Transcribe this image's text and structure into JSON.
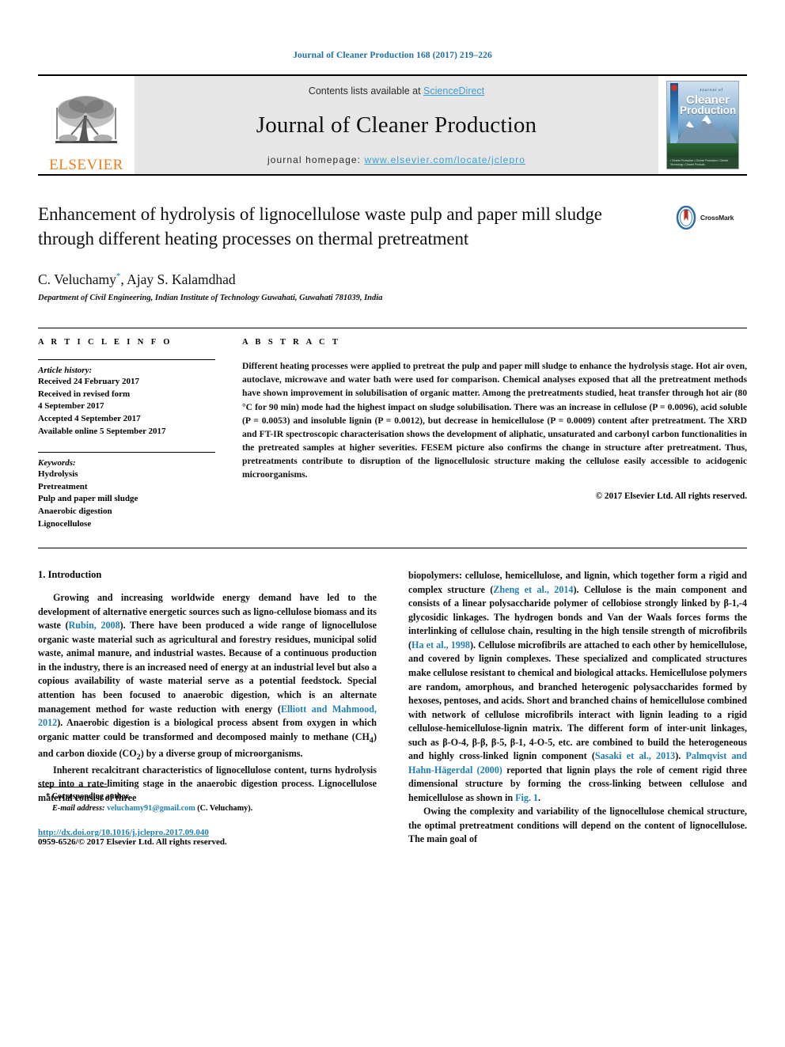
{
  "running_head": "Journal of Cleaner Production 168 (2017) 219–226",
  "masthead": {
    "publisher": "ELSEVIER",
    "contents_prefix": "Contents lists available at ",
    "contents_link": "ScienceDirect",
    "journal_title": "Journal of Cleaner Production",
    "homepage_prefix": "journal homepage: ",
    "homepage_url": "www.elsevier.com/locate/jclepro",
    "cover": {
      "small_top": "Journal of",
      "line1": "Cleaner",
      "line2": "Production",
      "footer_text": "• Cleaner Production  • Cleaner Production\n• Cleaner Technology  • Cleaner Products"
    }
  },
  "article": {
    "title": "Enhancement of hydrolysis of lignocellulose waste pulp and paper mill sludge through different heating processes on thermal pretreatment",
    "crossmark_label": "CrossMark",
    "authors": "C. Veluchamy",
    "authors_star": "*",
    "authors_rest": ", Ajay S. Kalamdhad",
    "affiliation": "Department of Civil Engineering, Indian Institute of Technology Guwahati, Guwahati 781039, India"
  },
  "info": {
    "heading": "A R T I C L E   I N F O",
    "history_label": "Article history:",
    "history_lines": [
      "Received 24 February 2017",
      "Received in revised form",
      "4 September 2017",
      "Accepted 4 September 2017",
      "Available online 5 September 2017"
    ],
    "keywords_label": "Keywords:",
    "keywords": [
      "Hydrolysis",
      "Pretreatment",
      "Pulp and paper mill sludge",
      "Anaerobic digestion",
      "Lignocellulose"
    ]
  },
  "abstract": {
    "heading": "A B S T R A C T",
    "text": "Different heating processes were applied to pretreat the pulp and paper mill sludge to enhance the hydrolysis stage. Hot air oven, autoclave, microwave and water bath were used for comparison. Chemical analyses exposed that all the pretreatment methods have shown improvement in solubilisation of organic matter. Among the pretreatments studied, heat transfer through hot air (80 °C for 90 min) mode had the highest impact on sludge solubilisation. There was an increase in cellulose (P = 0.0096), acid soluble (P = 0.0053) and insoluble lignin (P = 0.0012), but decrease in hemicellulose (P = 0.0009) content after pretreatment. The XRD and FT-IR spectroscopic characterisation shows the development of aliphatic, unsaturated and carbonyl carbon functionalities in the pretreated samples at higher severities. FESEM picture also confirms the change in structure after pretreatment. Thus, pretreatments contribute to disruption of the lignocellulosic structure making the cellulose easily accessible to acidogenic microorganisms.",
    "copyright": "© 2017 Elsevier Ltd. All rights reserved."
  },
  "body": {
    "section_title": "1. Introduction",
    "left_paragraphs": [
      {
        "parts": [
          {
            "t": "Growing and increasing worldwide energy demand have led to the development of alternative energetic sources such as ligno-cellulose biomass and its waste ("
          },
          {
            "t": "Rubin, 2008",
            "ref": true
          },
          {
            "t": "). There have been produced a wide range of lignocellulose organic waste material such as agricultural and forestry residues, municipal solid waste, animal manure, and industrial wastes. Because of a continuous production in the industry, there is an increased need of energy at an industrial level but also a copious availability of waste material serve as a potential feedstock. Special attention has been focused to anaerobic digestion, which is an alternate management method for waste reduction with energy ("
          },
          {
            "t": "Elliott and Mahmood, 2012",
            "ref": true
          },
          {
            "t": "). Anaerobic digestion is a biological process absent from oxygen in which organic matter could be transformed and decomposed mainly to methane (CH4) and carbon dioxide (CO2) by a diverse group of microorganisms."
          }
        ]
      },
      {
        "parts": [
          {
            "t": "Inherent recalcitrant characteristics of lignocellulose content, turns hydrolysis step into a rate-limiting stage in the anaerobic digestion process. Lignocellulose material consist of three"
          }
        ]
      }
    ],
    "right_paragraphs": [
      {
        "continued": true,
        "parts": [
          {
            "t": "biopolymers: cellulose, hemicellulose, and lignin, which together form a rigid and complex structure ("
          },
          {
            "t": "Zheng et al., 2014",
            "ref": true
          },
          {
            "t": "). Cellulose is the main component and consists of a linear polysaccharide polymer of cellobiose strongly linked by β-1,-4 glycosidic linkages. The hydrogen bonds and Van der Waals forces forms the interlinking of cellulose chain, resulting in the high tensile strength of microfibrils ("
          },
          {
            "t": "Ha et al., 1998",
            "ref": true
          },
          {
            "t": "). Cellulose microfibrils are attached to each other by hemicellulose, and covered by lignin complexes. These specialized and complicated structures make cellulose resistant to chemical and biological attacks. Hemicellulose polymers are random, amorphous, and branched heterogenic polysaccharides formed by hexoses, pentoses, and acids. Short and branched chains of hemicellulose combined with network of cellulose microfibrils interact with lignin leading to a rigid cellulose-hemicellulose-lignin matrix. The different form of inter-unit linkages, such as β-O-4, β-β, β-5, β-1, 4-O-5, etc. are combined to build the heterogeneous and highly cross-linked lignin component ("
          },
          {
            "t": "Sasaki et al., 2013",
            "ref": true
          },
          {
            "t": "). "
          },
          {
            "t": "Palmqvist and Hahn-Hägerdal (2000)",
            "ref": true
          },
          {
            "t": " reported that lignin plays the role of cement rigid three dimensional structure by forming the cross-linking between cellulose and hemicellulose as shown in "
          },
          {
            "t": "Fig. 1",
            "ref": true
          },
          {
            "t": "."
          }
        ]
      },
      {
        "parts": [
          {
            "t": "Owing the complexity and variability of the lignocellulose chemical structure, the optimal pretreatment conditions will depend on the content of lignocellulose. The main goal of"
          }
        ]
      }
    ]
  },
  "footnotes": {
    "corresponding_marker": "*",
    "corresponding_text": "Corresponding author.",
    "email_label": "E-mail address:",
    "email": "veluchamy91@gmail.com",
    "email_suffix": "(C. Veluchamy).",
    "doi": "http://dx.doi.org/10.1016/j.jclepro.2017.09.040",
    "issn": "0959-6526/© 2017 Elsevier Ltd. All rights reserved."
  },
  "colors": {
    "link": "#1f7fb5",
    "elsevier_orange": "#f07c1a",
    "sciencedirect": "#3a9fd4",
    "running_head": "#1f6fa8"
  }
}
